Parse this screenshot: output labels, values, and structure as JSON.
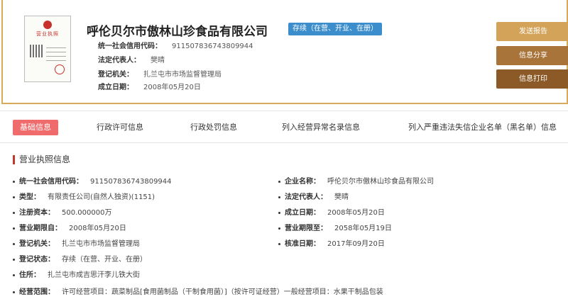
{
  "license_thumb": {
    "title": "营业执照"
  },
  "header": {
    "company_name": "呼伦贝尔市傲林山珍食品有限公司",
    "status": "存续（在营、开业、在册）",
    "credit_code_label": "统一社会信用代码：",
    "credit_code": "911507836743809944",
    "legal_rep_label": "法定代表人：",
    "legal_rep": "樊晴",
    "reg_authority_label": "登记机关：",
    "reg_authority": "扎兰屯市市场监督管理局",
    "established_label": "成立日期：",
    "established": "2008年05月20日"
  },
  "actions": {
    "send_report": "发送报告",
    "share": "信息分享",
    "print": "信息打印",
    "colors": {
      "send_report": "#d4a35a",
      "share": "#a9743a",
      "print": "#8b5a26"
    }
  },
  "tabs": [
    "基础信息",
    "行政许可信息",
    "行政处罚信息",
    "列入经营异常名录信息",
    "列入严重违法失信企业名单（黑名单）信息"
  ],
  "section": {
    "title": "营业执照信息",
    "left": [
      {
        "label": "统一社会信用代码：",
        "value": "911507836743809944"
      },
      {
        "label": "类型：",
        "value": "有限责任公司(自然人独资)(1151)"
      },
      {
        "label": "注册资本：",
        "value": "500.000000万"
      },
      {
        "label": "营业期限自：",
        "value": "2008年05月20日"
      },
      {
        "label": "登记机关：",
        "value": "扎兰屯市市场监督管理局"
      },
      {
        "label": "登记状态：",
        "value": "存续（在营、开业、在册）"
      },
      {
        "label": "住所：",
        "value": "扎兰屯市成吉思汗李儿铁大街"
      },
      {
        "label": "经营范围：",
        "value": "许可经营项目：蔬菜制品[食用菌制品（干制食用菌）]（按许可证经营）一般经营项目：水果干制品包装"
      }
    ],
    "right": [
      {
        "label": "企业名称：",
        "value": "呼伦贝尔市傲林山珍食品有限公司"
      },
      {
        "label": "法定代表人：",
        "value": "樊晴"
      },
      {
        "label": "成立日期：",
        "value": "2008年05月20日"
      },
      {
        "label": "营业期限至：",
        "value": "2058年05月19日"
      },
      {
        "label": "核准日期：",
        "value": "2017年09月20日"
      }
    ]
  }
}
